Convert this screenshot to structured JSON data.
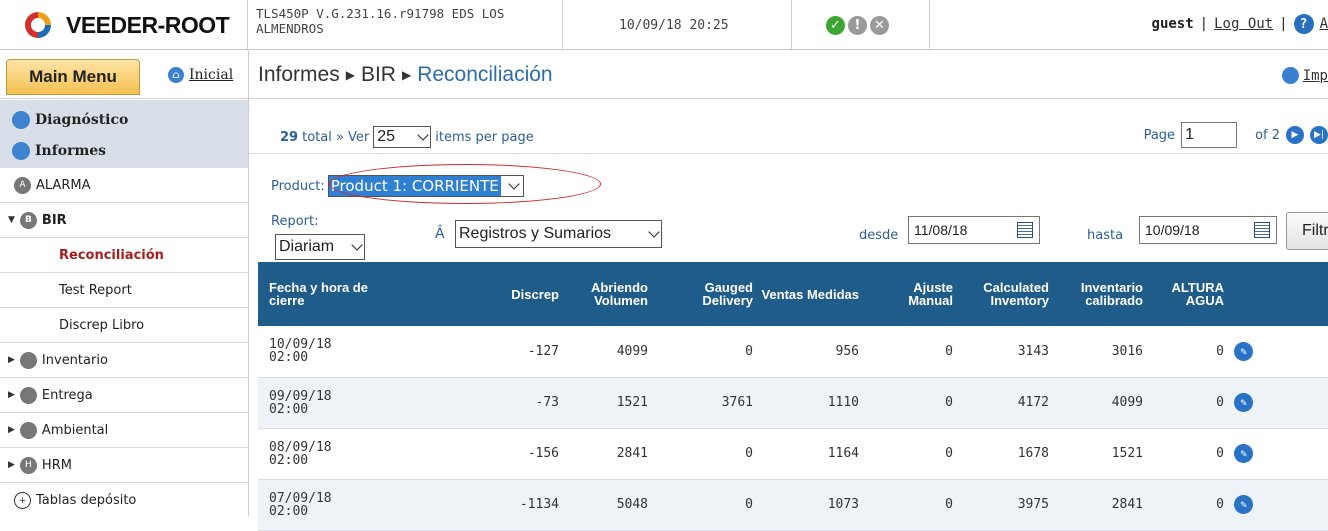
{
  "header": {
    "brand": "VEEDER-ROOT",
    "system_name": "TLS450P V.G.231.16.r91798 EDS LOS ALMENDROS",
    "datetime": "10/09/18 20:25",
    "status_icons": [
      "ok-icon",
      "warning-icon",
      "alarm-icon"
    ],
    "user": "guest",
    "logout": "Log Out",
    "help_partial": "A"
  },
  "toolbar": {
    "main_menu": "Main Menu",
    "home": "Inicial",
    "breadcrumb": [
      "Informes",
      "BIR",
      "Reconciliación"
    ],
    "print_partial": "Imp"
  },
  "sidebar": {
    "sections": [
      {
        "label": "Diagnóstico"
      },
      {
        "label": "Informes"
      }
    ],
    "items": [
      {
        "label": "ALARMA"
      },
      {
        "label": "BIR"
      },
      {
        "label": "Reconciliación"
      },
      {
        "label": "Test Report"
      },
      {
        "label": "Discrep Libro"
      },
      {
        "label": "Inventario"
      },
      {
        "label": "Entrega"
      },
      {
        "label": "Ambiental"
      },
      {
        "label": "HRM"
      },
      {
        "label": "Tablas depósito"
      }
    ]
  },
  "pager": {
    "total": "29",
    "total_suffix": "total » Ver",
    "per_page": "25",
    "per_page_suffix": "items per page",
    "page_label": "Page",
    "page": "1",
    "of_label": "of 2"
  },
  "filters": {
    "product_label": "Product:",
    "product": "Product 1: CORRIENTE",
    "report_label": "Report:",
    "report": "Diariam",
    "a_char": "Â",
    "register": "Registros y Sumarios",
    "from_label": "desde",
    "from": "11/08/18",
    "to_label": "hasta",
    "to": "10/09/18",
    "filter_button": "Filtro"
  },
  "table": {
    "headers": [
      "Fecha y hora de cierre",
      "Discrep",
      "Abriendo Volumen",
      "Gauged Delivery",
      "Ventas Medidas",
      "Ajuste Manual",
      "Calculated Inventory",
      "Inventario calibrado",
      "ALTURA AGUA"
    ],
    "rows": [
      {
        "date": "10/09/18",
        "time": "02:00",
        "discrep": "-127",
        "abriendo": "4099",
        "gauged": "0",
        "ventas": "956",
        "ajuste": "0",
        "calc": "3143",
        "calib": "3016",
        "agua": "0"
      },
      {
        "date": "09/09/18",
        "time": "02:00",
        "discrep": "-73",
        "abriendo": "1521",
        "gauged": "3761",
        "ventas": "1110",
        "ajuste": "0",
        "calc": "4172",
        "calib": "4099",
        "agua": "0"
      },
      {
        "date": "08/09/18",
        "time": "02:00",
        "discrep": "-156",
        "abriendo": "2841",
        "gauged": "0",
        "ventas": "1164",
        "ajuste": "0",
        "calc": "1678",
        "calib": "1521",
        "agua": "0"
      },
      {
        "date": "07/09/18",
        "time": "02:00",
        "discrep": "-1134",
        "abriendo": "5048",
        "gauged": "0",
        "ventas": "1073",
        "ajuste": "0",
        "calc": "3975",
        "calib": "2841",
        "agua": "0"
      }
    ]
  }
}
